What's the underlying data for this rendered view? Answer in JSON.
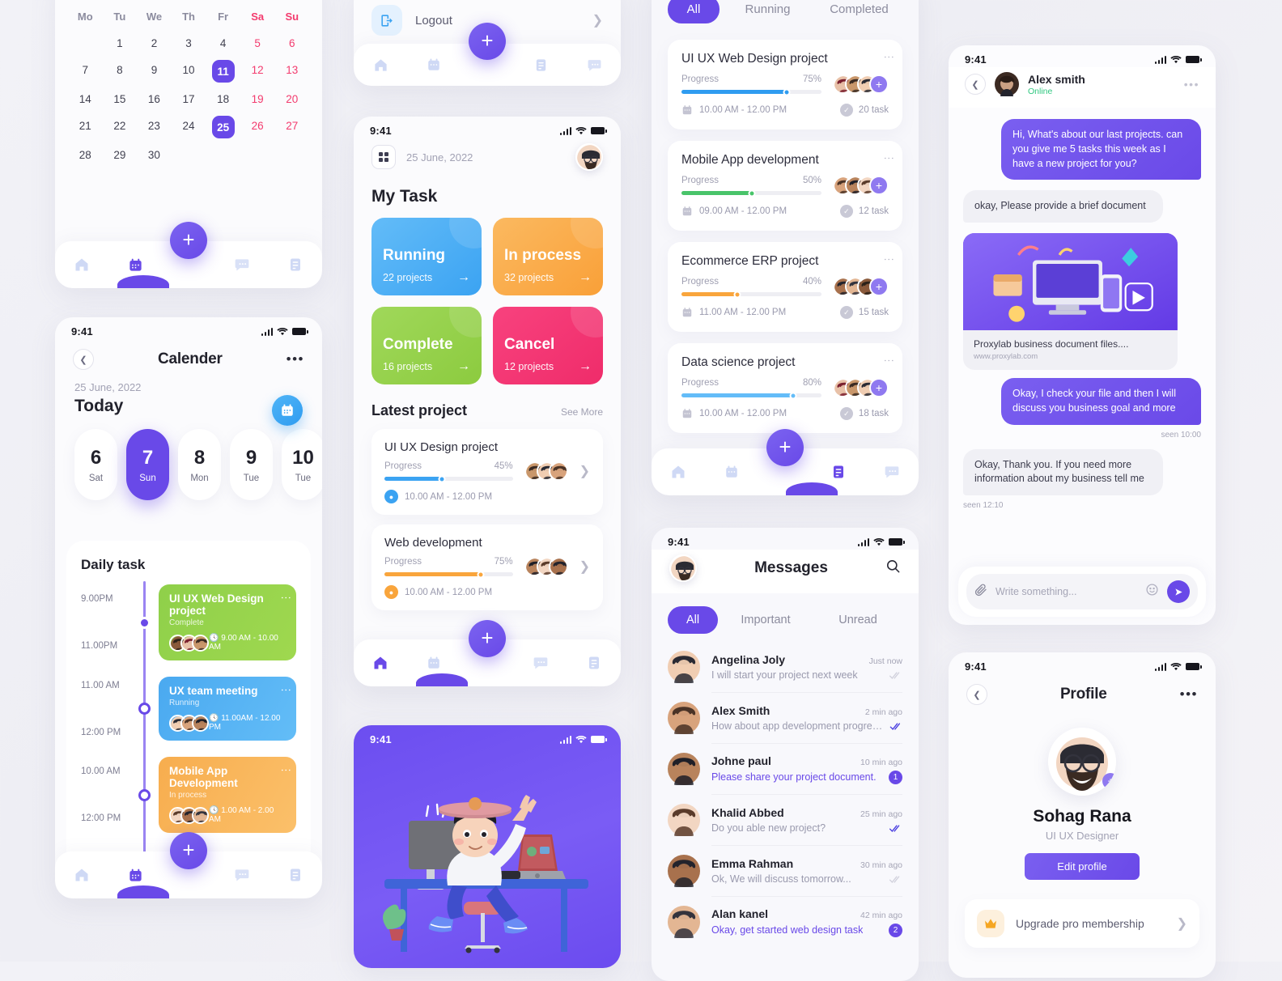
{
  "calendar_grid": {
    "weekdays": [
      "Mo",
      "Tu",
      "We",
      "Th",
      "Fr",
      "Sa",
      "Su"
    ],
    "weeks": [
      [
        "",
        "1",
        "2",
        "3",
        "4",
        "5",
        "6"
      ],
      [
        "7",
        "8",
        "9",
        "10",
        "11",
        "12",
        "13"
      ],
      [
        "14",
        "15",
        "16",
        "17",
        "18",
        "19",
        "20"
      ],
      [
        "21",
        "22",
        "23",
        "24",
        "25",
        "26",
        "27"
      ],
      [
        "28",
        "29",
        "30",
        "",
        "",
        "",
        ""
      ]
    ],
    "selected": [
      "11",
      "25"
    ]
  },
  "calendar_screen": {
    "status_time": "9:41",
    "title": "Calender",
    "date_label": "25 June, 2022",
    "today_label": "Today",
    "days": [
      {
        "num": "6",
        "dow": "Sat",
        "selected": false
      },
      {
        "num": "7",
        "dow": "Sun",
        "selected": true
      },
      {
        "num": "8",
        "dow": "Mon",
        "selected": false
      },
      {
        "num": "9",
        "dow": "Tue",
        "selected": false
      },
      {
        "num": "10",
        "dow": "Tue",
        "selected": false
      }
    ],
    "daily_task_label": "Daily task",
    "tasks": [
      {
        "start": "9.00PM",
        "end": "11.00PM",
        "title": "UI UX Web Design project",
        "status": "Complete",
        "time": "9.00 AM - 10.00 AM",
        "color": "green",
        "dot": "solid"
      },
      {
        "start": "11.00 AM",
        "end": "12:00 PM",
        "title": "UX team meeting",
        "status": "Running",
        "time": "11.00AM - 12.00 PM",
        "color": "blue",
        "dot": "hollow"
      },
      {
        "start": "10.00 AM",
        "end": "12:00 PM",
        "title": "Mobile App Development",
        "status": "In process",
        "time": "1.00 AM - 2.00 AM",
        "color": "orange",
        "dot": "hollow"
      }
    ]
  },
  "logout_card": {
    "label": "Logout"
  },
  "my_task": {
    "status_time": "9:41",
    "date_label": "25 June, 2022",
    "heading": "My Task",
    "tiles": [
      {
        "title": "Running",
        "count": "22 projects",
        "color": "t-blue"
      },
      {
        "title": "In process",
        "count": "32 projects",
        "color": "t-orange"
      },
      {
        "title": "Complete",
        "count": "16 projects",
        "color": "t-green"
      },
      {
        "title": "Cancel",
        "count": "12 projects",
        "color": "t-pink"
      }
    ],
    "latest_label": "Latest project",
    "see_more": "See More",
    "projects": [
      {
        "title": "UI UX Design project",
        "progress_label": "Progress",
        "percent": "45%",
        "pct": 45,
        "time": "10.00 AM - 12.00 PM",
        "color": "#3ba3f2"
      },
      {
        "title": "Web development",
        "progress_label": "Progress",
        "percent": "75%",
        "pct": 75,
        "time": "10.00 AM - 12.00 PM",
        "color": "#f9a53c"
      }
    ]
  },
  "illustration_screen": {
    "status_time": "9:41"
  },
  "project_list": {
    "tabs": [
      {
        "label": "All",
        "active": true
      },
      {
        "label": "Running",
        "active": false
      },
      {
        "label": "Completed",
        "active": false
      }
    ],
    "projects": [
      {
        "title": "UI UX Web Design project",
        "progress_label": "Progress",
        "percent": "75%",
        "pct": 75,
        "time": "10.00 AM - 12.00 PM",
        "tasks": "20 task",
        "color": "#2f9cf0"
      },
      {
        "title": "Mobile App development",
        "progress_label": "Progress",
        "percent": "50%",
        "pct": 50,
        "time": "09.00 AM - 12.00 PM",
        "tasks": "12 task",
        "color": "#49c46a"
      },
      {
        "title": "Ecommerce ERP project",
        "progress_label": "Progress",
        "percent": "40%",
        "pct": 40,
        "time": "11.00 AM - 12.00 PM",
        "tasks": "15 task",
        "color": "#f9a53c"
      },
      {
        "title": "Data science project",
        "progress_label": "Progress",
        "percent": "80%",
        "pct": 80,
        "time": "10.00 AM - 12.00 PM",
        "tasks": "18 task",
        "color": "#63bcf8"
      }
    ]
  },
  "messages": {
    "status_time": "9:41",
    "title": "Messages",
    "tabs": [
      {
        "label": "All",
        "active": true
      },
      {
        "label": "Important",
        "active": false
      },
      {
        "label": "Unread",
        "active": false
      }
    ],
    "items": [
      {
        "name": "Angelina Joly",
        "preview": "I will start your project next week",
        "time": "Just now",
        "unread": false,
        "badge": "",
        "ticks": "gray"
      },
      {
        "name": "Alex Smith",
        "preview": "How about  app development progress?",
        "time": "2 min ago",
        "unread": false,
        "badge": "",
        "ticks": "blue"
      },
      {
        "name": "Johne paul",
        "preview": "Please share your project document.",
        "time": "10 min ago",
        "unread": true,
        "badge": "1",
        "ticks": ""
      },
      {
        "name": "Khalid Abbed",
        "preview": "Do you able new project?",
        "time": "25 min ago",
        "unread": false,
        "badge": "",
        "ticks": "blue"
      },
      {
        "name": "Emma Rahman",
        "preview": "Ok, We will discuss tomorrow...",
        "time": "30 min ago",
        "unread": false,
        "badge": "",
        "ticks": "gray"
      },
      {
        "name": "Alan kanel",
        "preview": "Okay, get started web design task",
        "time": "42 min ago",
        "unread": true,
        "badge": "2",
        "ticks": ""
      }
    ]
  },
  "chat": {
    "status_time": "9:41",
    "name": "Alex smith",
    "presence": "Online",
    "messages": [
      {
        "from": "me",
        "text": "Hi, What's about our last projects. can you give me 5 tasks this week as I have a new project for you?"
      },
      {
        "from": "them",
        "text": "okay, Please provide a brief document"
      }
    ],
    "link_card": {
      "title": "Proxylab business document files....",
      "url": "www.proxylab.com"
    },
    "messages2": [
      {
        "from": "me",
        "text": "Okay, I check your file and then I will discuss you business goal and more",
        "seen": "seen 10:00"
      },
      {
        "from": "them",
        "text": "Okay, Thank you. If you need more information about my business tell me",
        "seen": "seen 12:10"
      }
    ],
    "composer_placeholder": "Write something..."
  },
  "profile": {
    "status_time": "9:41",
    "title": "Profile",
    "name": "Sohag Rana",
    "role": "UI UX Designer",
    "edit_label": "Edit profile",
    "upgrade_label": "Upgrade pro membership"
  },
  "colors": {
    "primary": "#6949e8",
    "blue": "#3ba3f2",
    "green": "#8ccb3f",
    "orange": "#f9a53c",
    "pink": "#ef2c6a",
    "weekend": "#f33b6e"
  }
}
